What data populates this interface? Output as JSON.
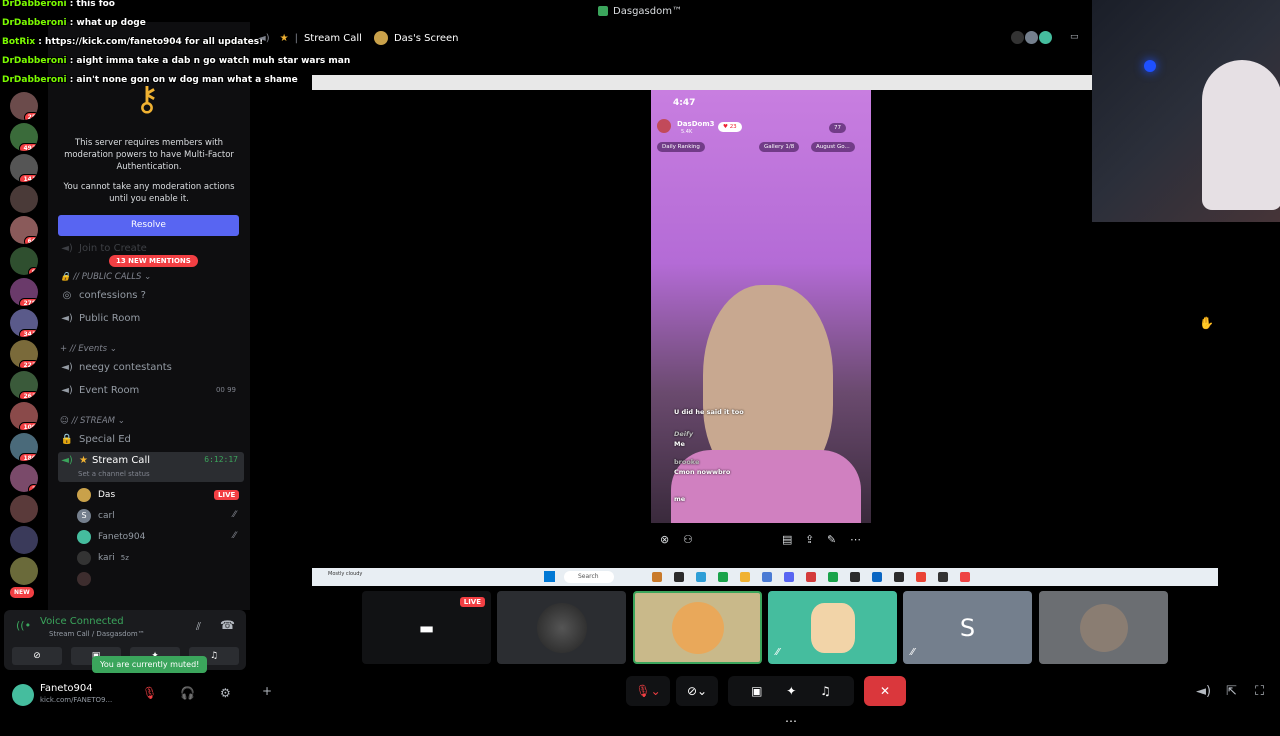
{
  "window": {
    "title": "Dasgasdom™"
  },
  "servers": [
    {
      "badge": "25"
    },
    {
      "badge": "492"
    },
    {
      "badge": "141"
    },
    {
      "badge": ""
    },
    {
      "badge": "66"
    },
    {
      "badge": "9"
    },
    {
      "badge": "278"
    },
    {
      "badge": "341"
    },
    {
      "badge": "223"
    },
    {
      "badge": "263"
    },
    {
      "badge": "109"
    },
    {
      "badge": "180"
    },
    {
      "badge": "3"
    },
    {
      "badge": ""
    },
    {
      "badge": ""
    },
    {
      "badge": ""
    }
  ],
  "new_badge": "NEW",
  "chat_overlay": [
    {
      "name": "DrDabberoni",
      "text": " : this foo"
    },
    {
      "name": "DrDabberoni",
      "text": " : what up doge"
    },
    {
      "name": "BotRix",
      "text": " : https://kick.com/faneto904 for all updates!"
    },
    {
      "name": "DrDabberoni",
      "text": " : aight imma take a dab n go watch muh star wars man"
    },
    {
      "name": "DrDabberoni",
      "text": " : ain't none gon on w dog man what a shame"
    }
  ],
  "mfa": {
    "line1": "This server requires members with moderation powers to have Multi-Factor Authentication.",
    "line2": "You cannot take any moderation actions until you enable it.",
    "button": "Resolve"
  },
  "mentions_badge": "13 NEW MENTIONS",
  "hidden_channel": "Join to Create",
  "categories": {
    "public": "// PUBLIC CALLS",
    "events": "// Events",
    "stream": "// STREAM"
  },
  "channels": {
    "confessions": "confessions ?",
    "public_room": "Public Room",
    "neegy": "neegy contestants",
    "event_room": "Event Room",
    "event_counts": "00  99",
    "special_ed": "Special Ed",
    "stream_call": "Stream Call",
    "stream_timer": "6:12:17",
    "channel_status": "Set a channel status"
  },
  "voice_users": [
    {
      "name": "Das",
      "initial": "",
      "live": "LIVE"
    },
    {
      "name": "carl",
      "initial": "S",
      "live": ""
    },
    {
      "name": "Faneto904",
      "initial": "",
      "live": ""
    },
    {
      "name": "kari",
      "initial": "",
      "live": "",
      "extra": "5z"
    }
  ],
  "voice_panel": {
    "status": "Voice Connected",
    "channel": "Stream Call / Dasgasdom™",
    "muted_tip": "You are currently muted!"
  },
  "user": {
    "name": "Faneto904",
    "status": "kick.com/FANETO9..."
  },
  "header": {
    "channel": "Stream Call",
    "screen": "Das's Screen"
  },
  "phone": {
    "time": "4:47",
    "streamer": "DasDom3",
    "followers": "5.4K",
    "likes": "23",
    "viewers": "77",
    "daily_ranking": "Daily Ranking",
    "gallery": "Gallery",
    "gallery_count": "1/8",
    "august": "August Go...",
    "chat": [
      {
        "user": "",
        "text": "U did he said it too"
      },
      {
        "user": "Deify",
        "text": "Me"
      },
      {
        "user": "brooke",
        "text": "Cmon nowwbro"
      },
      {
        "user": "",
        "text": "me"
      }
    ]
  },
  "taskbar": {
    "search": "Search",
    "weather": "Mostly cloudy"
  },
  "tiles": [
    {
      "kind": "screen",
      "live": "LIVE"
    },
    {
      "kind": "avatar"
    },
    {
      "kind": "avatar"
    },
    {
      "kind": "avatar"
    },
    {
      "kind": "letter",
      "letter": "S"
    },
    {
      "kind": "avatar"
    }
  ],
  "colors": {
    "accent": "#5865f2",
    "live": "#f23f43",
    "connected": "#3ba55c",
    "leave": "#da373c"
  }
}
